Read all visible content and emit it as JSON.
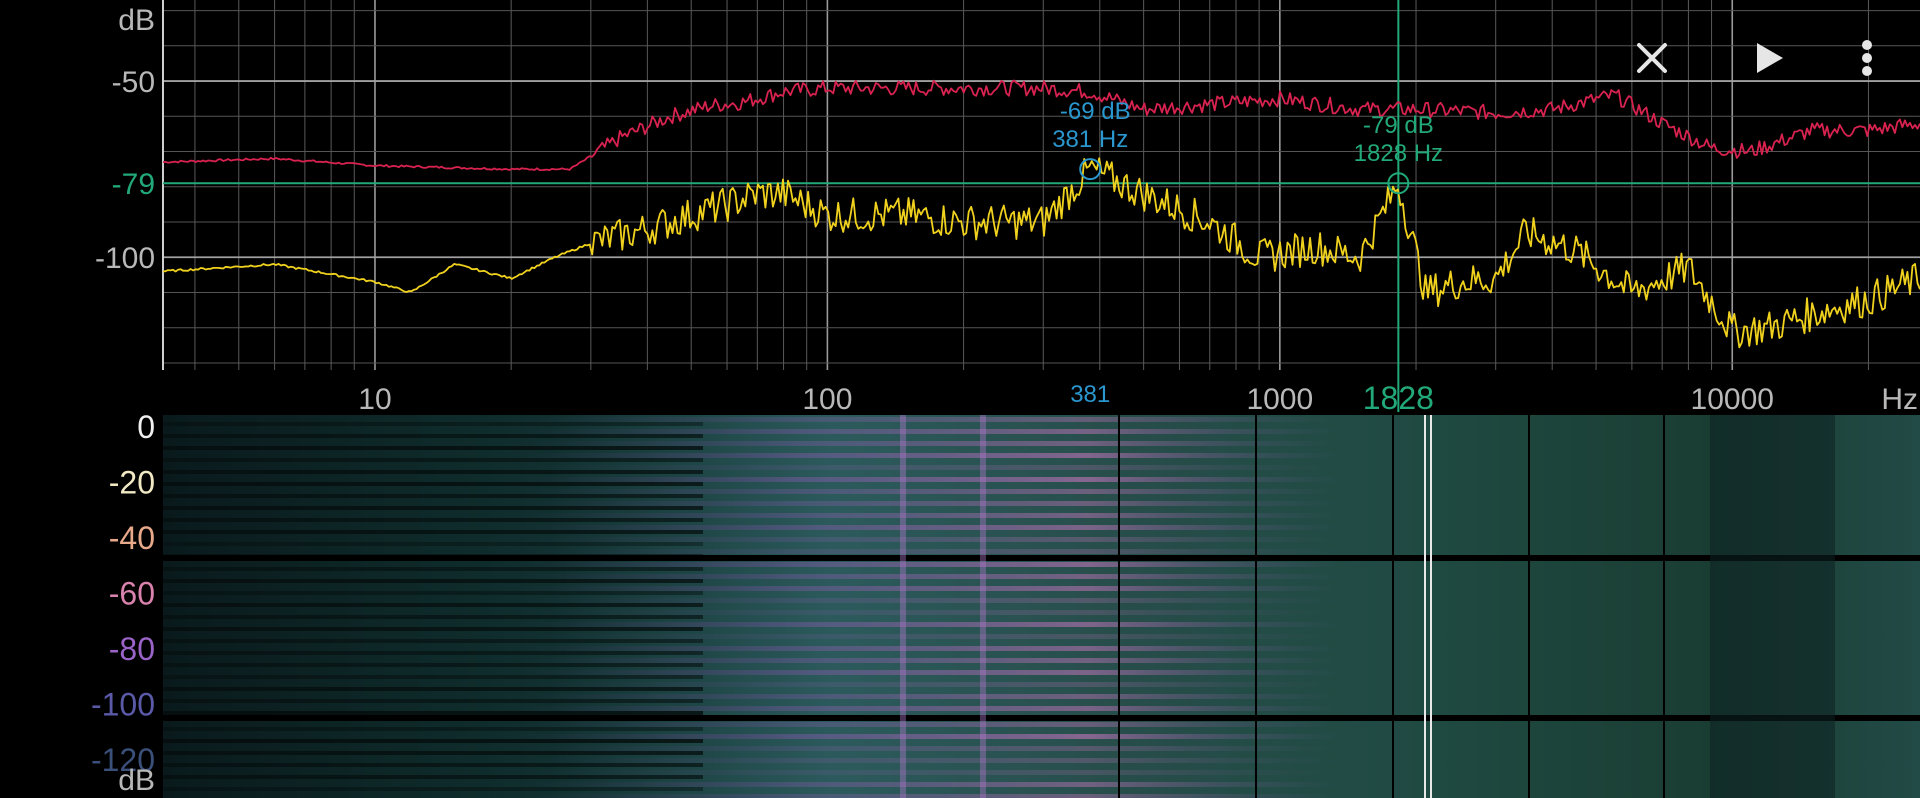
{
  "toolbar": {
    "close_icon": "close-icon",
    "play_icon": "play-icon",
    "menu_icon": "more-vert-icon"
  },
  "chart_data": [
    {
      "type": "line",
      "title": "",
      "xlabel": "Hz",
      "ylabel": "dB",
      "x_scale": "log",
      "xlim": [
        3.4,
        26000
      ],
      "ylim": [
        -132,
        -27
      ],
      "x_ticks": [
        10,
        100,
        1000,
        10000
      ],
      "x_tick_labels": [
        "10",
        "100",
        "1000",
        "10000"
      ],
      "y_ticks": [
        -50,
        -100
      ],
      "y_tick_labels": [
        "-50",
        "-100"
      ],
      "grid": true,
      "series": [
        {
          "color": "#d8224f",
          "x": [
            3.4,
            6,
            10,
            20,
            27,
            35,
            45,
            55,
            65,
            80,
            100,
            150,
            200,
            300,
            381,
            500,
            800,
            1000,
            1500,
            2000,
            3000,
            4000,
            5500,
            7000,
            9000,
            11000,
            15000,
            20000,
            26000
          ],
          "y": [
            -73,
            -72,
            -74,
            -75,
            -75,
            -66,
            -60,
            -57,
            -56,
            -53,
            -52,
            -52,
            -52,
            -52,
            -53,
            -58,
            -56,
            -55,
            -58,
            -58,
            -59,
            -58,
            -54,
            -62,
            -69,
            -70,
            -64,
            -64,
            -62
          ]
        },
        {
          "color": "#f0d21e",
          "x": [
            3.4,
            6,
            10,
            12,
            15,
            20,
            25,
            30,
            40,
            50,
            60,
            70,
            80,
            100,
            150,
            200,
            300,
            381,
            500,
            700,
            900,
            1200,
            1500,
            1828,
            2100,
            2500,
            3000,
            3500,
            4500,
            6000,
            8000,
            10000,
            12000,
            16000,
            20000,
            26000
          ],
          "y": [
            -104,
            -102,
            -107,
            -110,
            -102,
            -106,
            -100,
            -96,
            -92,
            -88,
            -85,
            -82,
            -82,
            -88,
            -88,
            -90,
            -90,
            -75,
            -82,
            -90,
            -100,
            -97,
            -100,
            -79,
            -110,
            -107,
            -106,
            -93,
            -98,
            -110,
            -103,
            -121,
            -120,
            -115,
            -112,
            -106
          ]
        }
      ],
      "annotations": [
        {
          "text": "-69 dB",
          "color": "#2a97cf",
          "x": 381,
          "y": -75
        },
        {
          "text": "381 Hz",
          "color": "#2a97cf",
          "x": 381,
          "y": -75
        },
        {
          "text": "-79 dB",
          "color": "#22a979",
          "x": 1828,
          "y": -79
        },
        {
          "text": "1828 Hz",
          "color": "#22a979",
          "x": 1828,
          "y": -79
        }
      ],
      "cursor": {
        "x": 1828,
        "y": -79,
        "x_label": "1828",
        "y_label": "-79",
        "color": "#22a979"
      },
      "marker_label": {
        "x": 381,
        "text": "381",
        "color": "#2a97cf"
      }
    },
    {
      "type": "heatmap",
      "xlabel": "Hz",
      "ylabel": "dB",
      "x_scale": "log",
      "xlim": [
        3.4,
        26000
      ],
      "colorbar_ticks": [
        "0",
        "-20",
        "-40",
        "-60",
        "-80",
        "-100",
        "-120"
      ],
      "colorbar_unit": "dB",
      "colorbar_colors": [
        "#f0f0f0",
        "#f1e9c4",
        "#e8a98a",
        "#d982ad",
        "#9a63c7",
        "#5a5aa8",
        "#3a4f7a"
      ]
    }
  ]
}
